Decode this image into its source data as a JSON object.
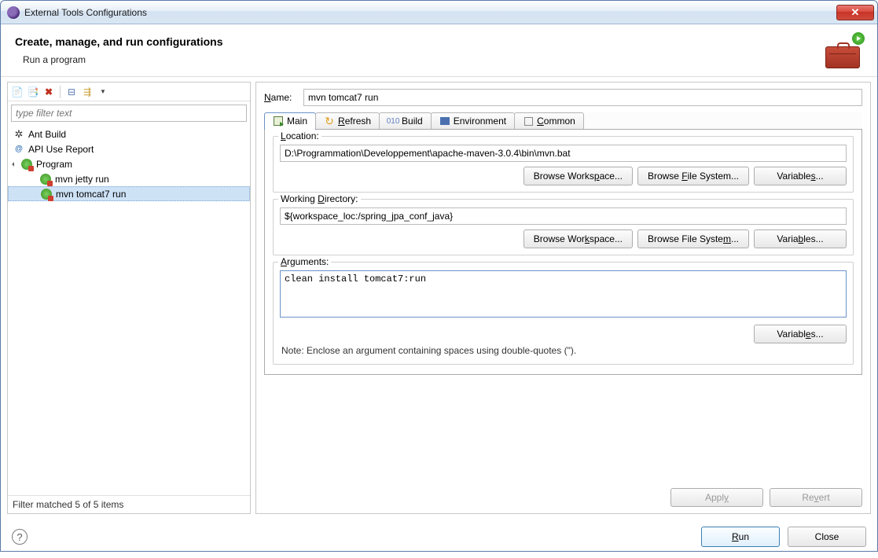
{
  "window": {
    "title": "External Tools Configurations"
  },
  "header": {
    "title": "Create, manage, and run configurations",
    "subtitle": "Run a program"
  },
  "left": {
    "filter_placeholder": "type filter text",
    "items": [
      {
        "label": "Ant Build",
        "icon": "ant"
      },
      {
        "label": "API Use Report",
        "icon": "api"
      },
      {
        "label": "Program",
        "icon": "program",
        "expanded": true
      }
    ],
    "children": [
      {
        "label": "mvn jetty run"
      },
      {
        "label": "mvn tomcat7 run",
        "selected": true
      }
    ],
    "filter_status": "Filter matched 5 of 5 items"
  },
  "form": {
    "name_label": "Name:",
    "name_value": "mvn tomcat7 run",
    "tabs": {
      "main": "Main",
      "refresh": "Refresh",
      "build": "Build",
      "environment": "Environment",
      "common": "Common"
    },
    "location": {
      "label": "Location:",
      "value": "D:\\Programmation\\Developpement\\apache-maven-3.0.4\\bin\\mvn.bat"
    },
    "workdir": {
      "label": "Working Directory:",
      "value": "${workspace_loc:/spring_jpa_conf_java}"
    },
    "arguments": {
      "label": "Arguments:",
      "value": "clean install tomcat7:run"
    },
    "buttons": {
      "browse_workspace": "Browse Workspace...",
      "browse_filesystem": "Browse File System...",
      "variables": "Variables..."
    },
    "note": "Note: Enclose an argument containing spaces using double-quotes (\").",
    "apply": "Apply",
    "revert": "Revert"
  },
  "footer": {
    "run": "Run",
    "close": "Close"
  }
}
